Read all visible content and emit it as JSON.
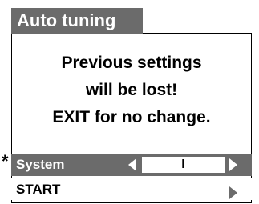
{
  "title": "Auto tuning",
  "message": {
    "line1": "Previous settings",
    "line2": "will be lost!",
    "line3": "EXIT for no change."
  },
  "selected_marker": "*",
  "menu": {
    "system": {
      "label": "System",
      "value": "I",
      "left_arrow_icon": "triangle-left-icon",
      "right_arrow_icon": "triangle-right-icon"
    },
    "start": {
      "label": "START",
      "arrow_icon": "triangle-right-icon"
    }
  },
  "colors": {
    "header_gray": "#6b6b6b",
    "text_black": "#000000",
    "text_white": "#ffffff"
  }
}
